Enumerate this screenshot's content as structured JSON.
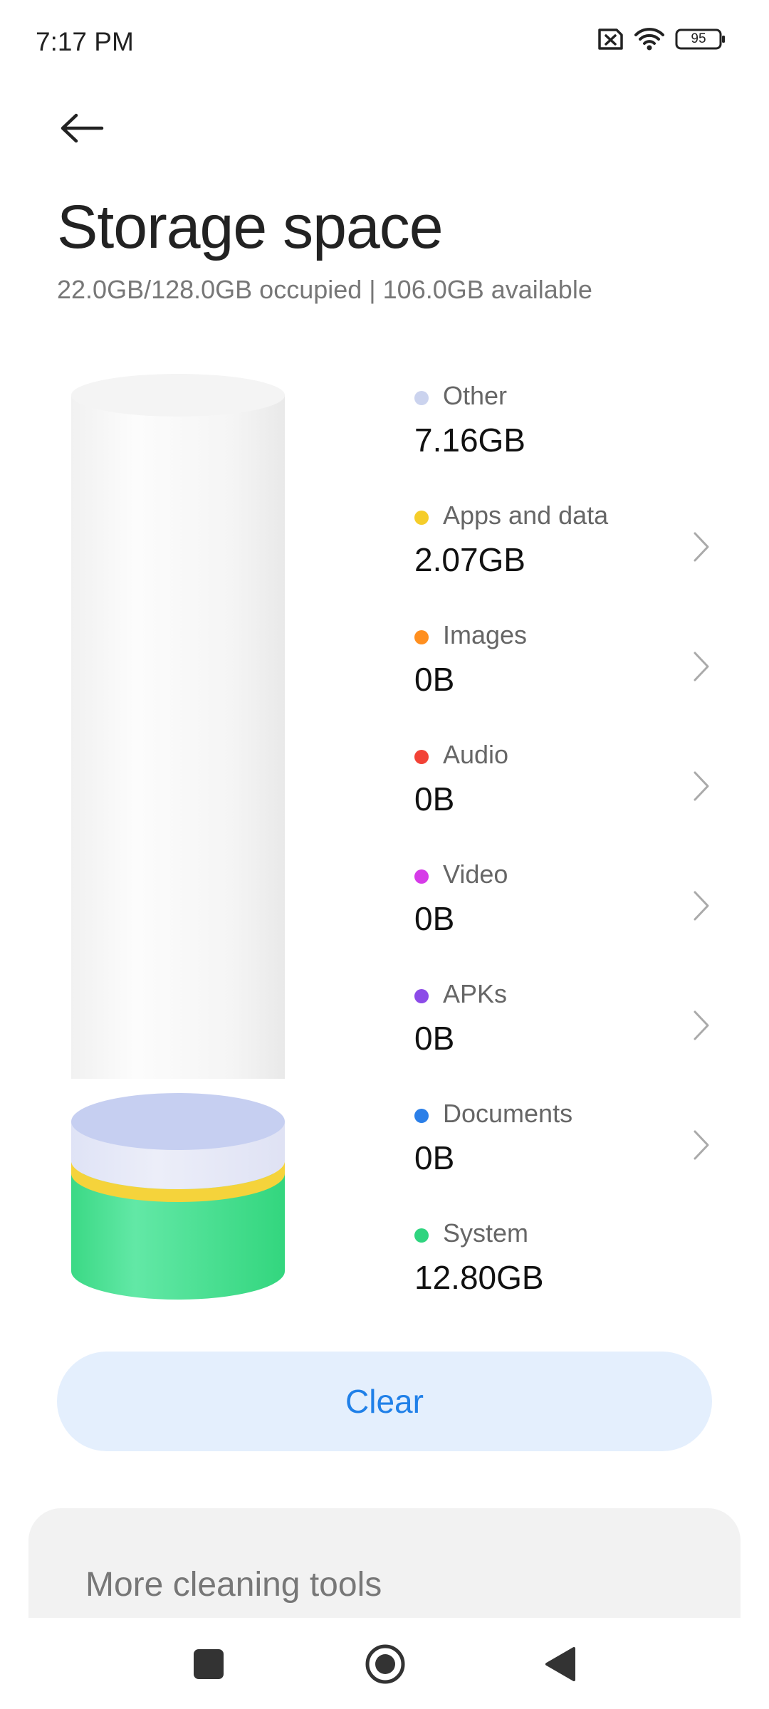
{
  "status_bar": {
    "time": "7:17 PM",
    "battery": "95",
    "icons": [
      "sim-off-icon",
      "wifi-icon",
      "battery-icon"
    ]
  },
  "header": {
    "back_icon": "back-arrow-icon",
    "title": "Storage space",
    "subtitle": "22.0GB/128.0GB occupied | 106.0GB available"
  },
  "storage": {
    "total_gb": 128.0,
    "used_gb": 22.0,
    "segments_bottom_to_top": [
      {
        "name": "System",
        "gb": 12.8,
        "color": "#3ddc84"
      },
      {
        "name": "Apps and data",
        "gb": 2.07,
        "color": "#f5d33b"
      },
      {
        "name": "Other",
        "gb": 7.16,
        "color": "#c9d3f2"
      }
    ]
  },
  "categories": [
    {
      "label": "Other",
      "value": "7.16GB",
      "color": "#cbd3ee",
      "chevron": false
    },
    {
      "label": "Apps and data",
      "value": "2.07GB",
      "color": "#f5cd2a",
      "chevron": true
    },
    {
      "label": "Images",
      "value": "0B",
      "color": "#ff8f1f",
      "chevron": true
    },
    {
      "label": "Audio",
      "value": "0B",
      "color": "#f24236",
      "chevron": true
    },
    {
      "label": "Video",
      "value": "0B",
      "color": "#d63be8",
      "chevron": true
    },
    {
      "label": "APKs",
      "value": "0B",
      "color": "#8c4be8",
      "chevron": true
    },
    {
      "label": "Documents",
      "value": "0B",
      "color": "#2b7fe8",
      "chevron": true
    },
    {
      "label": "System",
      "value": "12.80GB",
      "color": "#2fd47f",
      "chevron": false
    }
  ],
  "actions": {
    "clear_label": "Clear"
  },
  "tools": {
    "title": "More cleaning tools"
  },
  "nav": {
    "icons": [
      "recents-square-icon",
      "home-circle-icon",
      "back-triangle-icon"
    ]
  }
}
